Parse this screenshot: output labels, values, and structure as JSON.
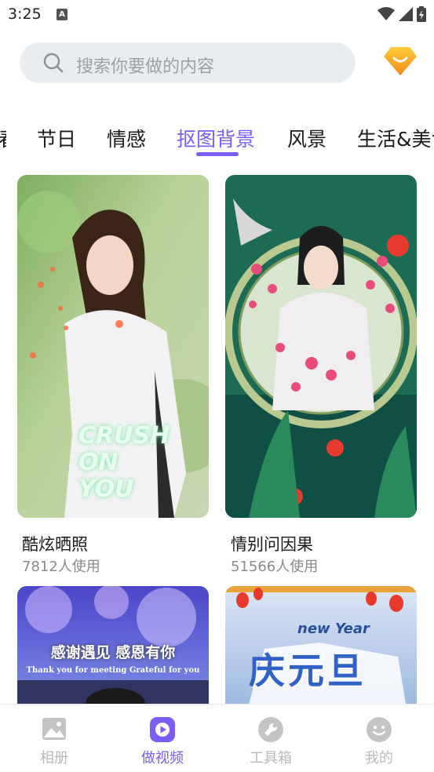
{
  "status_bar": {
    "time": "3:25",
    "notification": "A"
  },
  "search": {
    "placeholder": "搜索你要做的内容"
  },
  "tabs": [
    {
      "label": "节日"
    },
    {
      "label": "情感"
    },
    {
      "label": "抠图背景",
      "active": true
    },
    {
      "label": "风景"
    },
    {
      "label": "生活&美食"
    }
  ],
  "cards": [
    {
      "title": "酷炫晒照",
      "usage": "7812人使用",
      "overlay_text": "CRUSH ON YOU"
    },
    {
      "title": "情别问因果",
      "usage": "51566人使用"
    },
    {
      "overlay_title": "感谢遇见 感恩有你",
      "overlay_subtitle": "Thank you for meeting  Grateful for you"
    },
    {
      "overlay_title": "new Year",
      "overlay_cn": "庆元旦"
    }
  ],
  "bottom_nav": [
    {
      "label": "相册",
      "icon": "photo-album-icon"
    },
    {
      "label": "做视频",
      "icon": "play-icon",
      "active": true
    },
    {
      "label": "工具箱",
      "icon": "wrench-icon"
    },
    {
      "label": "我的",
      "icon": "smiley-icon"
    }
  ],
  "colors": {
    "accent": "#7b5cf5",
    "search_bg": "#e9edf0",
    "vip": "#f5a623"
  }
}
